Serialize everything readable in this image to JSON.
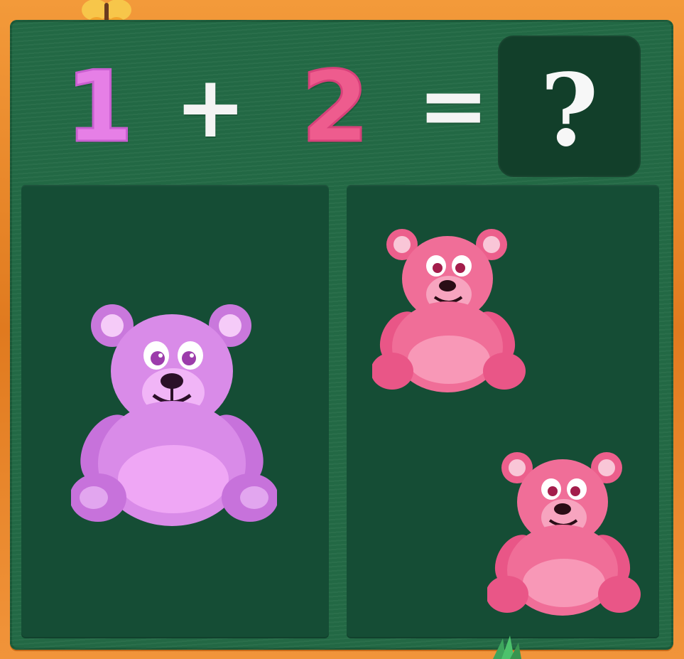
{
  "equation": {
    "first_number": "1",
    "operator": "+",
    "second_number": "2",
    "equals": "=",
    "answer": "?"
  },
  "groups": {
    "left": {
      "bear_count": 1,
      "bear_color": "purple"
    },
    "right": {
      "bear_count": 2,
      "bear_color": "pink"
    }
  },
  "colors": {
    "board": "#236a45",
    "panel": "#154d35",
    "answer_box": "#123f2a",
    "frame": "#e8862a",
    "purple_bear": "#d98be8",
    "pink_bear": "#f06e98"
  },
  "decorations": {
    "top_left": "butterfly-icon",
    "bottom_center": "grass-icon"
  }
}
